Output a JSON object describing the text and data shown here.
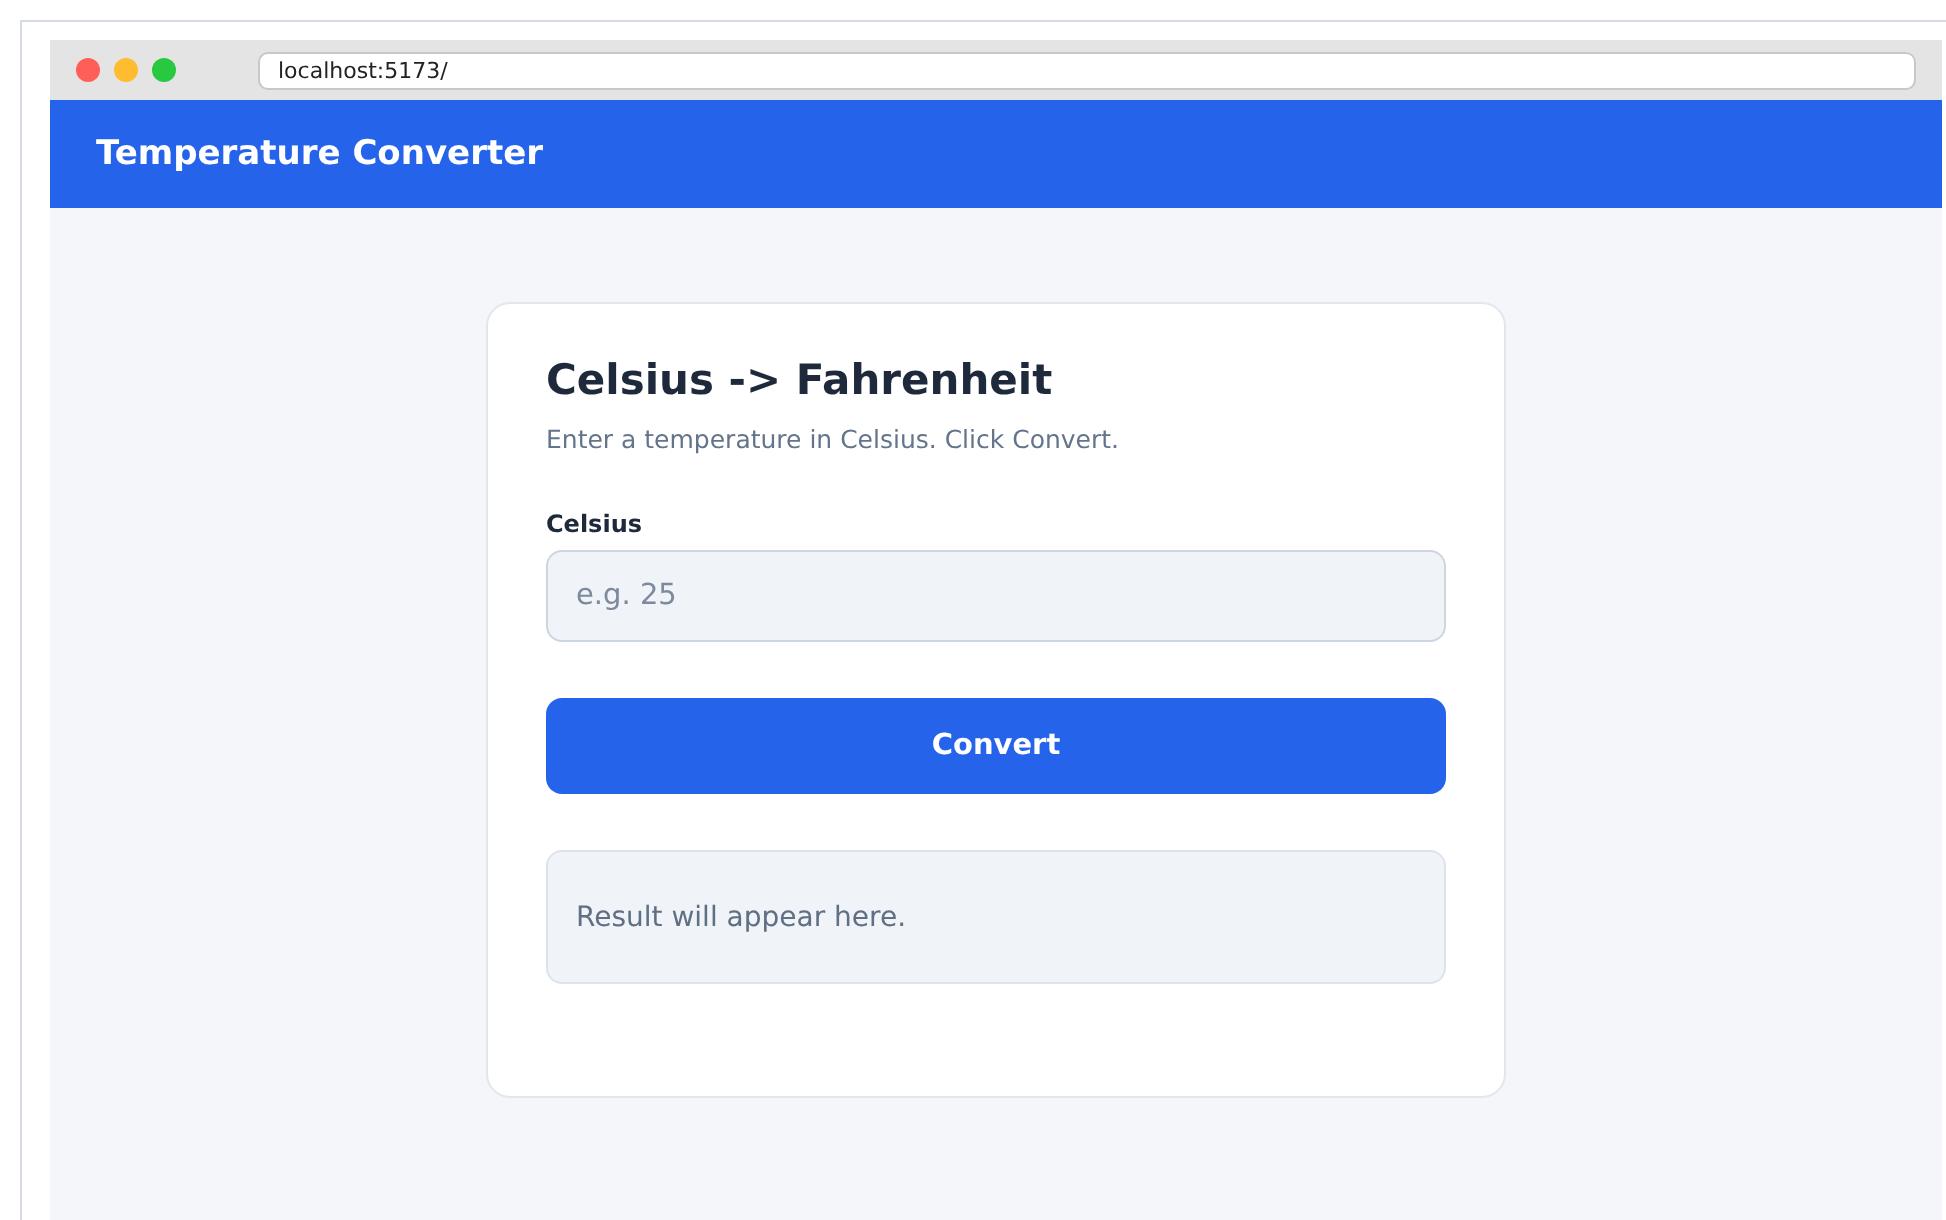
{
  "browser": {
    "address": "localhost:5173/"
  },
  "header": {
    "title": "Temperature Converter"
  },
  "card": {
    "title": "Celsius -> Fahrenheit",
    "subtitle": "Enter a temperature in Celsius. Click Convert.",
    "field": {
      "label": "Celsius",
      "placeholder": "e.g. 25"
    },
    "button": "Convert",
    "result": "Result will appear here."
  }
}
